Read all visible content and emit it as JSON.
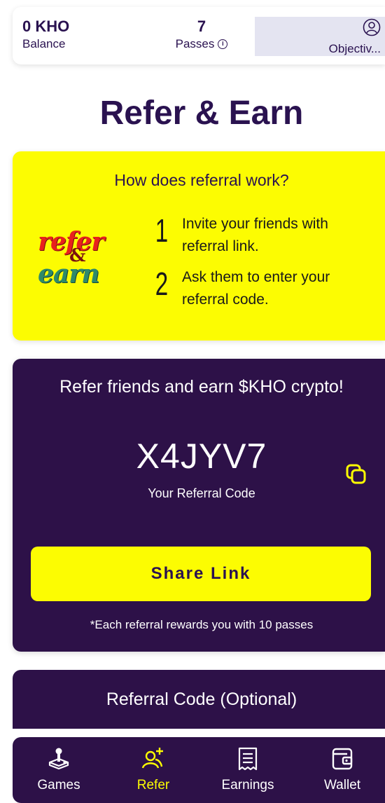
{
  "stats": {
    "balance_value": "0 KHO",
    "balance_label": "Balance",
    "passes_value": "7",
    "passes_label": "Passes",
    "objective_label": "Objectiv..."
  },
  "page": {
    "title": "Refer & Earn"
  },
  "how_it_works": {
    "title": "How does referral work?",
    "logo_top": "refer",
    "logo_amp": "&",
    "logo_bottom": "earn",
    "steps": [
      {
        "number": "1",
        "text": "Invite your friends with referral link."
      },
      {
        "number": "2",
        "text": "Ask them to enter your referral code."
      }
    ]
  },
  "referral": {
    "title": "Refer friends and earn $KHO crypto!",
    "code": "X4JYV7",
    "code_label": "Your Referral Code",
    "share_button": "Share Link",
    "reward_note": "*Each referral rewards you with 10 passes"
  },
  "optional_code": {
    "title": "Referral Code (Optional)"
  },
  "bottom_nav": {
    "items": [
      {
        "label": "Games",
        "icon": "joystick-icon"
      },
      {
        "label": "Refer",
        "icon": "add-user-icon",
        "active": true
      },
      {
        "label": "Earnings",
        "icon": "receipt-icon"
      },
      {
        "label": "Wallet",
        "icon": "wallet-icon"
      }
    ]
  },
  "colors": {
    "brand_purple": "#2d1148",
    "brand_yellow": "#fcfc02",
    "text_dark": "#2a1250",
    "objective_bg": "#e4e4f1"
  }
}
